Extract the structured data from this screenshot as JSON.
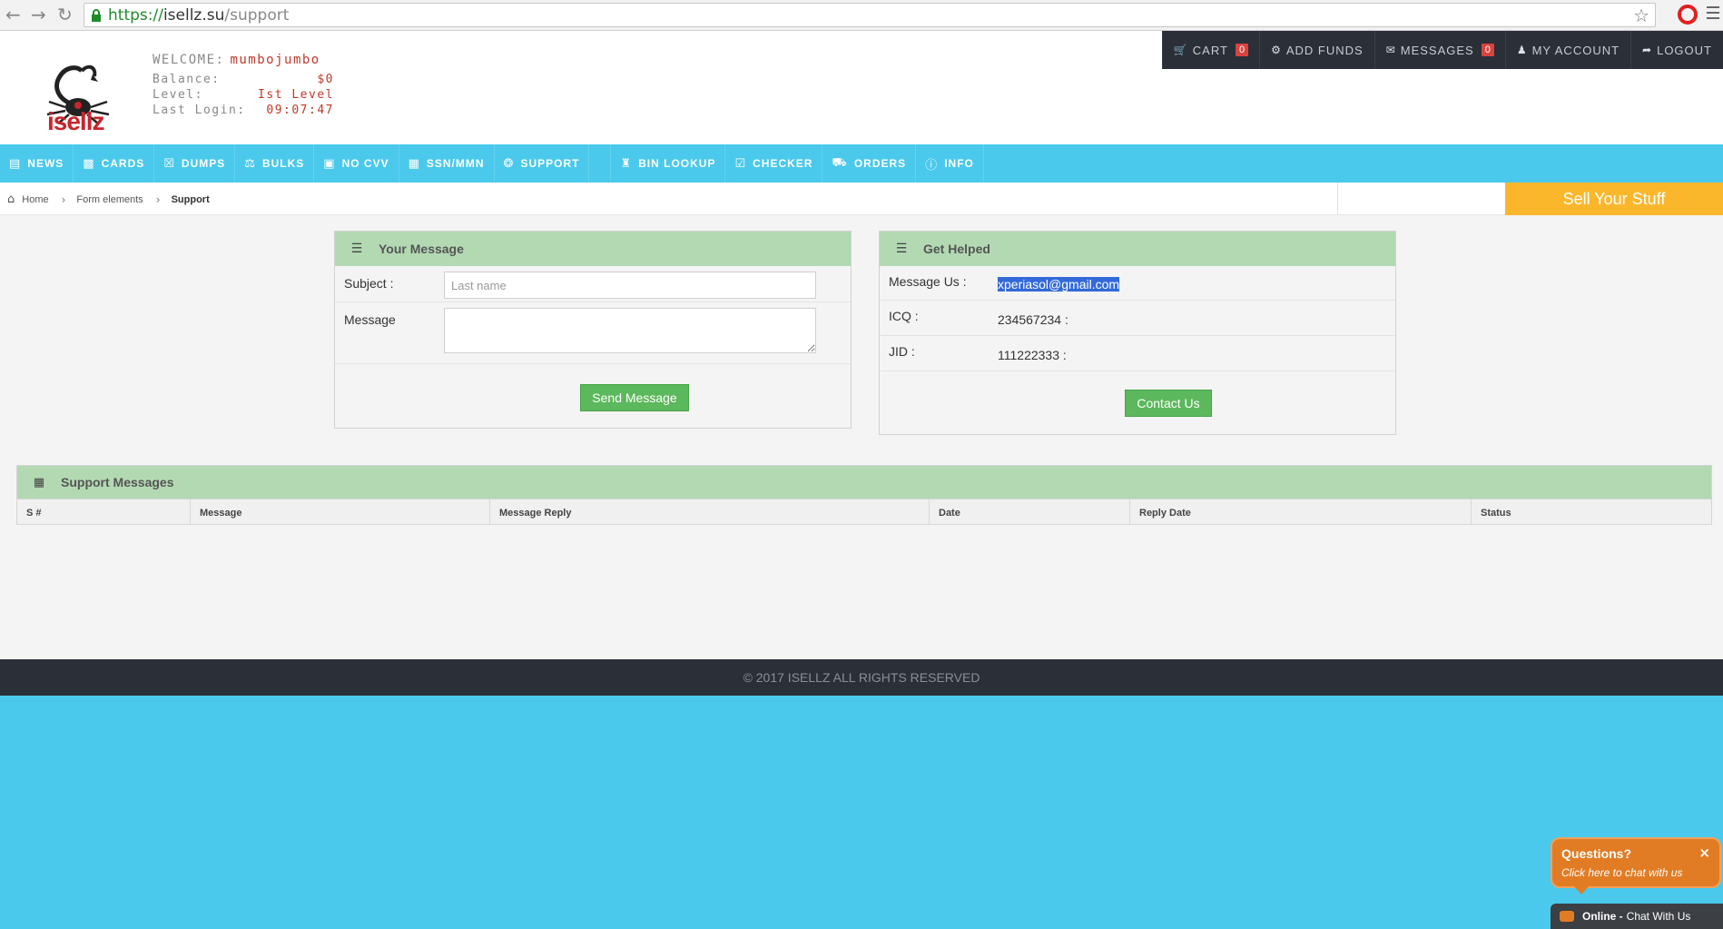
{
  "browser": {
    "url_scheme": "https://",
    "url_host": "isellz.su",
    "url_path": "/support"
  },
  "header": {
    "logo_text": "isellz",
    "welcome_label": "WELCOME:",
    "username": "mumbojumbo",
    "balance_label": "Balance:",
    "balance_value": "$0",
    "level_label": "Level:",
    "level_value": "Ist Level",
    "last_login_label": "Last Login:",
    "last_login_value": "09:07:47"
  },
  "topnav": {
    "cart_label": "CART",
    "cart_count": "0",
    "add_funds_label": "ADD FUNDS",
    "messages_label": "MESSAGES",
    "messages_count": "0",
    "account_label": "MY ACCOUNT",
    "logout_label": "LOGOUT"
  },
  "mainnav": {
    "news": "NEWS",
    "cards": "CARDS",
    "dumps": "DUMPS",
    "bulks": "BULKS",
    "no_cvv": "NO CVV",
    "ssn": "SSN/MMN",
    "support": "SUPPORT",
    "bin_lookup": "BIN LOOKUP",
    "checker": "CHECKER",
    "orders": "ORDERS",
    "info": "INFO"
  },
  "breadcrumb": {
    "home": "Home",
    "form_elements": "Form elements",
    "current": "Support"
  },
  "sell_button": "Sell Your Stuff",
  "your_message": {
    "title": "Your Message",
    "subject_label": "Subject :",
    "subject_placeholder": "Last name",
    "message_label": "Message",
    "send_button": "Send Message"
  },
  "get_helped": {
    "title": "Get Helped",
    "message_us_label": "Message Us :",
    "message_us_value": "xperiasol@gmail.com",
    "icq_label": "ICQ :",
    "icq_value": "234567234 :",
    "jid_label": "JID :",
    "jid_value": "111222333 :",
    "contact_button": "Contact Us"
  },
  "support_messages": {
    "title": "Support Messages",
    "columns": [
      "S #",
      "Message",
      "Message Reply",
      "Date",
      "Reply Date",
      "Status"
    ]
  },
  "footer": "© 2017 ISELLZ ALL RIGHTS RESERVED",
  "chat": {
    "title": "Questions?",
    "subtitle": "Click here to chat with us",
    "close": "×",
    "status": "Online -",
    "bar_label": "Chat With Us"
  }
}
